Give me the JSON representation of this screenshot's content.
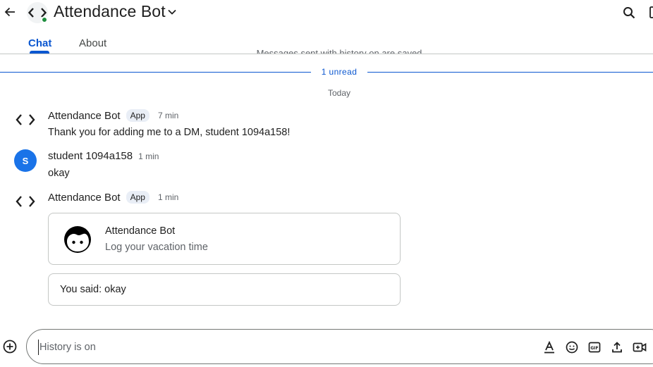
{
  "header": {
    "title": "Attendance Bot",
    "icons": {
      "back": "arrow-back-icon",
      "app_avatar": "code-brackets-icon",
      "chevron": "chevron-down-icon",
      "search": "search-icon",
      "panel": "side-panel-icon"
    },
    "presence_color": "#1e8e3e"
  },
  "tabs": [
    {
      "label": "Chat",
      "active": true
    },
    {
      "label": "About",
      "active": false
    }
  ],
  "history_notice": "Messages sent with history on are saved",
  "unread_label": "1 unread",
  "date_label": "Today",
  "messages": [
    {
      "sender": "Attendance Bot",
      "badge": "App",
      "time": "7 min",
      "text": "Thank you for adding me to a DM, student 1094a158!"
    },
    {
      "sender": "student 1094a158",
      "avatar_letter": "S",
      "time": "1 min",
      "text": "okay"
    },
    {
      "sender": "Attendance Bot",
      "badge": "App",
      "time": "1 min",
      "card": {
        "title": "Attendance Bot",
        "subtitle": "Log your vacation time",
        "icon": "face-avatar-icon"
      },
      "reply": "You said: okay"
    }
  ],
  "composer": {
    "placeholder": "History is on",
    "tools": [
      "add-icon",
      "format-text-icon",
      "emoji-icon",
      "gif-icon",
      "upload-icon",
      "video-call-icon"
    ]
  },
  "colors": {
    "accent": "#0b57d0",
    "user_avatar": "#1a73e8"
  }
}
